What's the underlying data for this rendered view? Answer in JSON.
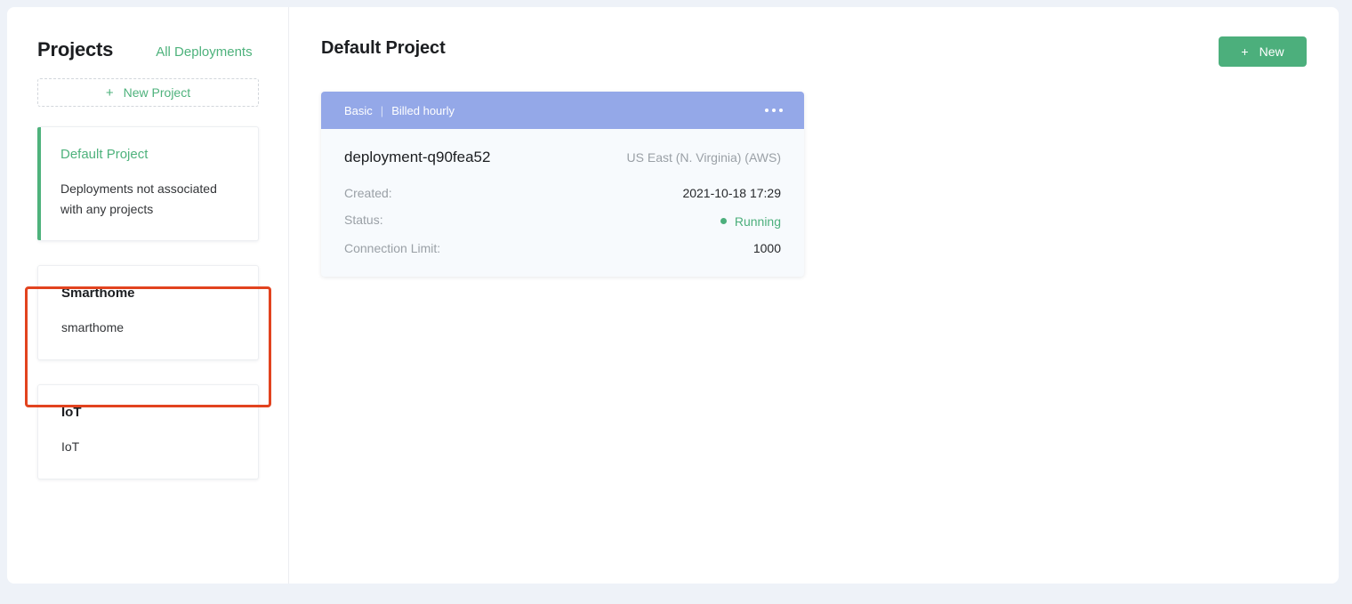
{
  "sidebar": {
    "title": "Projects",
    "all_deployments_label": "All Deployments",
    "new_project_label": "New Project",
    "plus_glyph": "+",
    "projects": [
      {
        "name": "Default Project",
        "description": "Deployments not associated with any projects",
        "active": true
      },
      {
        "name": "Smarthome",
        "description": "smarthome",
        "active": false
      },
      {
        "name": "IoT",
        "description": "IoT",
        "active": false
      }
    ]
  },
  "main": {
    "title": "Default Project",
    "new_button_label": "New",
    "plus_glyph": "+",
    "deployment": {
      "plan": "Basic",
      "separator": "|",
      "billing": "Billed hourly",
      "name": "deployment-q90fea52",
      "region": "US East (N. Virginia) (AWS)",
      "rows": [
        {
          "label": "Created:",
          "value": "2021-10-18 17:29"
        },
        {
          "label": "Status:",
          "value": "Running"
        },
        {
          "label": "Connection Limit:",
          "value": "1000"
        }
      ]
    }
  },
  "colors": {
    "accent_green": "#4caf7c",
    "header_blue": "#94a8e8",
    "annotation_red": "#e2431f",
    "page_background": "#eef2f8"
  }
}
